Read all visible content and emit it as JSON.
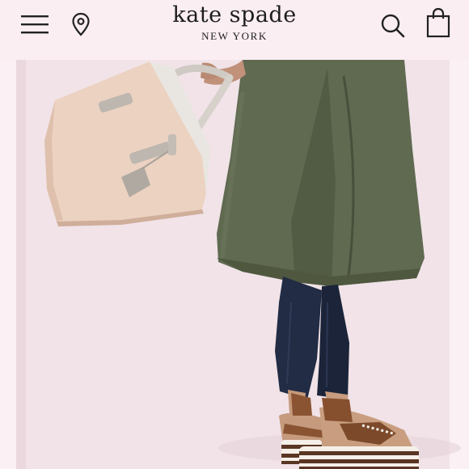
{
  "header": {
    "brand_name": "kate spade",
    "brand_sub": "NEW YORK",
    "icons": {
      "menu": "hamburger-menu-icon",
      "location": "map-pin-icon",
      "search": "search-icon",
      "bag": "shopping-bag-icon"
    }
  },
  "colors": {
    "header_bg": "#fbeef2",
    "page_bg": "#f3e6ea",
    "icon": "#222222"
  },
  "hero": {
    "image_subject": "model holding blush satchel wearing olive skirt, dark jeans and striped platform sandals"
  }
}
